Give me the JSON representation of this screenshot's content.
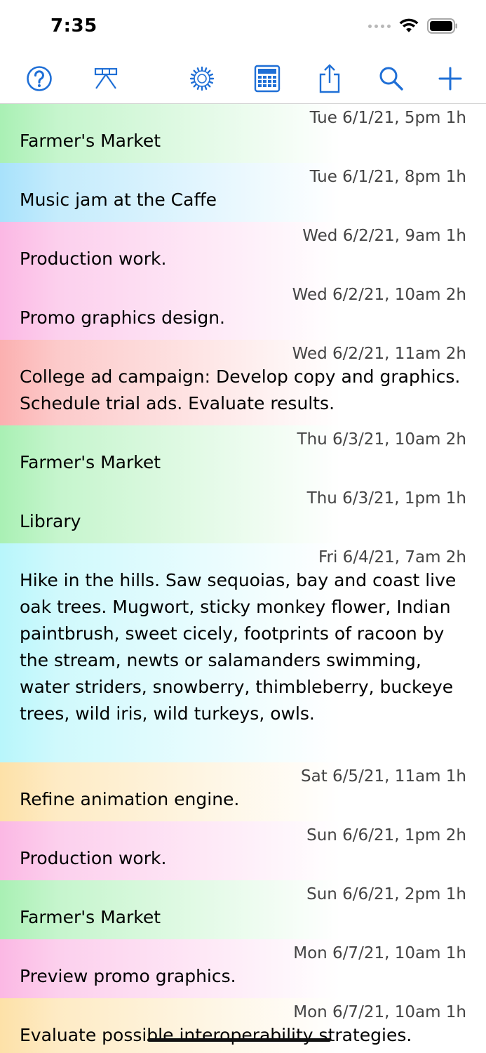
{
  "status": {
    "time": "7:35"
  },
  "toolbar": {
    "buttons": [
      {
        "name": "help-icon"
      },
      {
        "name": "timeline-icon"
      },
      {
        "name": "gear-icon"
      },
      {
        "name": "calculator-icon"
      },
      {
        "name": "share-icon"
      },
      {
        "name": "search-icon"
      },
      {
        "name": "add-icon"
      }
    ],
    "accent": "#1f6fd6"
  },
  "events": [
    {
      "date": "Tue 6/1/21, 5pm 1h",
      "text": "Farmer's Market",
      "color": "#a9f0b4"
    },
    {
      "date": "Tue 6/1/21, 8pm 1h",
      "text": "Music jam at the Caffe",
      "color": "#a8e2fb"
    },
    {
      "date": "Wed 6/2/21, 9am 1h",
      "text": "Production work.",
      "color": "#fbb8e4"
    },
    {
      "date": "Wed 6/2/21, 10am 2h",
      "text": "Promo graphics design.",
      "color": "#fbb8e4"
    },
    {
      "date": "Wed 6/2/21, 11am 2h",
      "text": "College ad campaign: Develop copy and graphics. Schedule trial ads. Evaluate results.",
      "color": "#fbb0b0"
    },
    {
      "date": "Thu 6/3/21, 10am 2h",
      "text": "Farmer's Market",
      "color": "#a9f0b4"
    },
    {
      "date": "Thu 6/3/21, 1pm 1h",
      "text": "Library",
      "color": "#a9f0b4"
    },
    {
      "date": "Fri 6/4/21, 7am 2h",
      "text": "Hike in the hills. Saw sequoias, bay and coast live oak trees. Mugwort, sticky monkey flower, Indian paintbrush, sweet cicely, footprints of racoon by the stream, newts or salamanders swimming, water striders, snowberry, thimbleberry, buckeye trees, wild iris, wild turkeys, owls.",
      "color": "#b8f6fb"
    },
    {
      "date": "Sat 6/5/21, 11am 1h",
      "text": "Refine animation engine.",
      "color": "#fde1a8"
    },
    {
      "date": "Sun 6/6/21, 1pm 2h",
      "text": "Production work.",
      "color": "#fbb8e4"
    },
    {
      "date": "Sun 6/6/21, 2pm 1h",
      "text": "Farmer's Market",
      "color": "#a9f0b4"
    },
    {
      "date": "Mon 6/7/21, 10am 1h",
      "text": "Preview promo graphics.",
      "color": "#fbb8e4"
    },
    {
      "date": "Mon 6/7/21, 10am 1h",
      "text": "Evaluate possible interoperability strategies.",
      "color": "#fde1a8"
    }
  ]
}
